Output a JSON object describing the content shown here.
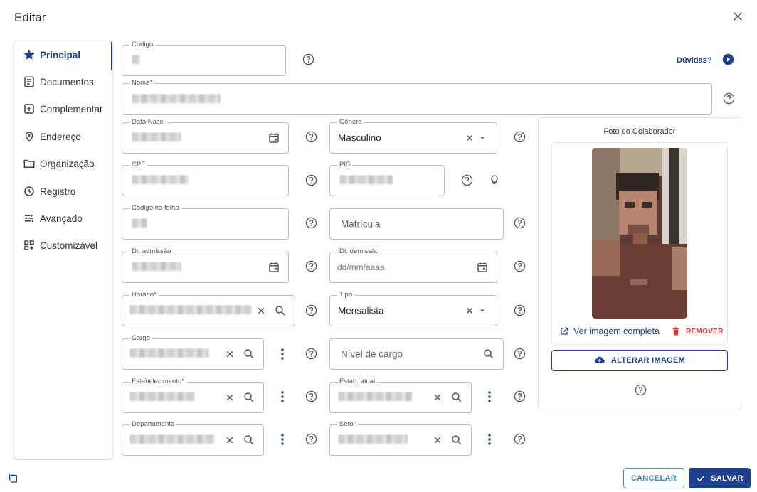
{
  "dialog": {
    "title": "Editar"
  },
  "sidebar": {
    "items": [
      {
        "label": "Principal",
        "icon": "star-icon"
      },
      {
        "label": "Documentos",
        "icon": "document-icon"
      },
      {
        "label": "Complementar",
        "icon": "plus-box-icon"
      },
      {
        "label": "Endereço",
        "icon": "location-icon"
      },
      {
        "label": "Organização",
        "icon": "folder-icon"
      },
      {
        "label": "Registro",
        "icon": "clock-icon"
      },
      {
        "label": "Avançado",
        "icon": "sliders-icon"
      },
      {
        "label": "Customizável",
        "icon": "grid-plus-icon"
      }
    ]
  },
  "help_link": {
    "label": "Dúvidas?"
  },
  "form": {
    "codigo": {
      "label": "Código"
    },
    "nome": {
      "label": "Nome*"
    },
    "data_nasc": {
      "label": "Data Nasc."
    },
    "genero": {
      "label": "Gênero",
      "value": "Masculino"
    },
    "cpf": {
      "label": "CPF"
    },
    "pis": {
      "label": "PIS"
    },
    "codigo_folha": {
      "label": "Código na folha"
    },
    "matricula": {
      "placeholder": "Matrícula"
    },
    "dt_admissao": {
      "label": "Dt. admissão"
    },
    "dt_demissao": {
      "label": "Dt. demissão",
      "placeholder": "dd/mm/aaaa"
    },
    "horario": {
      "label": "Horário*"
    },
    "tipo": {
      "label": "Tipo",
      "value": "Mensalista"
    },
    "cargo": {
      "label": "Cargo"
    },
    "nivel_cargo": {
      "placeholder": "Nível de cargo"
    },
    "estabelecimento": {
      "label": "Estabelecimento*"
    },
    "estab_atual": {
      "label": "Estab. atual"
    },
    "departamento": {
      "label": "Departamento"
    },
    "setor": {
      "label": "Setor"
    }
  },
  "photo": {
    "title": "Foto do Colaborador",
    "view_label": "Ver imagem completa",
    "remove_label": "REMOVER",
    "change_label": "ALTERAR IMAGEM"
  },
  "footer": {
    "cancel_label": "CANCELAR",
    "save_label": "SALVAR"
  },
  "colors": {
    "primary": "#1f3f8f",
    "danger": "#e53935",
    "cancel_border": "#4a90c2"
  }
}
